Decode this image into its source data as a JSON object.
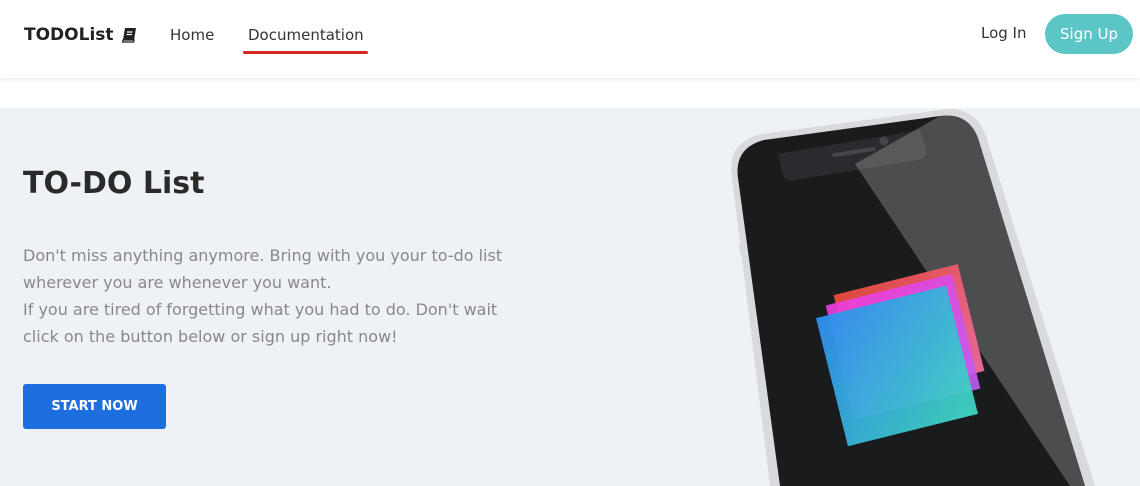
{
  "navbar": {
    "brand": "TODOList",
    "brand_icon": "book-icon",
    "links": [
      {
        "label": "Home"
      },
      {
        "label": "Documentation",
        "active": true
      }
    ],
    "login_label": "Log In",
    "signup_label": "Sign Up"
  },
  "hero": {
    "title": "TO-DO List",
    "paragraph_1": "Don't miss anything anymore. Bring with you your to-do list wherever you are whenever you want.",
    "paragraph_2": "If you are tired of forgetting what you had to do. Don't wait click on the button below or sign up right now!",
    "cta_label": "START NOW",
    "illustration": "phone-illustration"
  },
  "colors": {
    "active_underline": "#d32626",
    "signup_bg": "#5cc6c6",
    "cta_bg": "#1d6fe0",
    "hero_bg": "#eef2f6"
  }
}
